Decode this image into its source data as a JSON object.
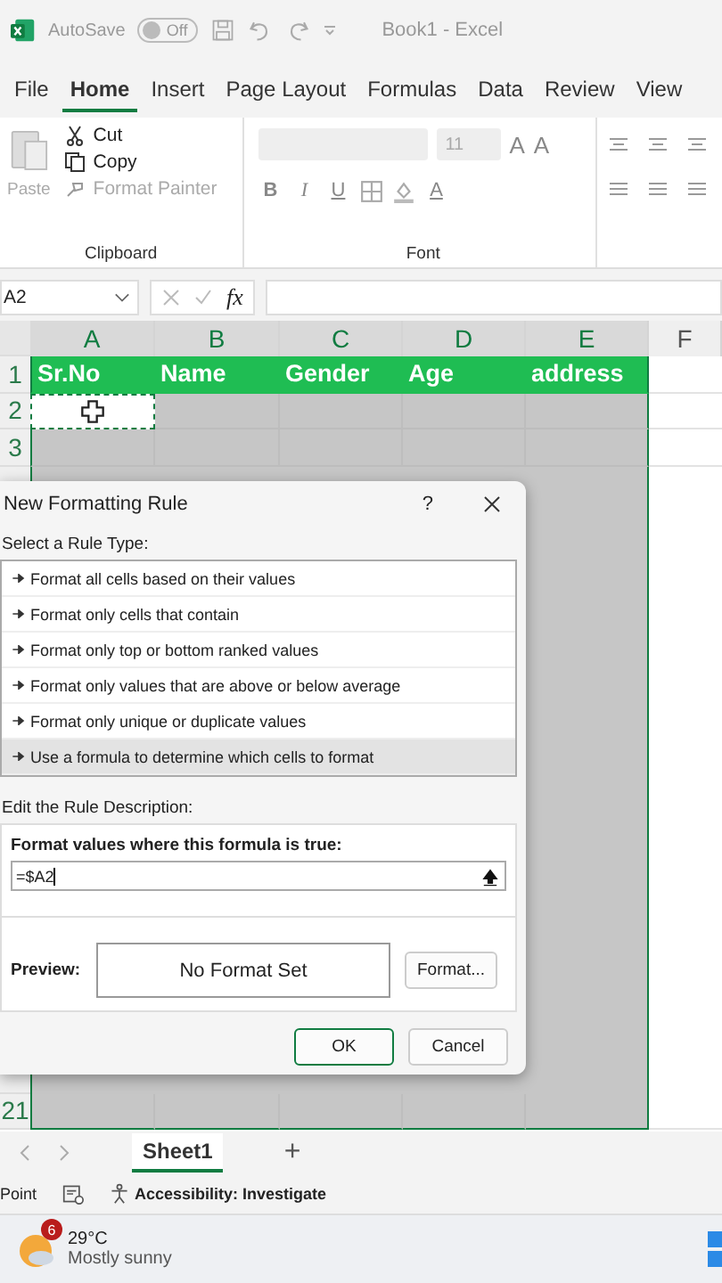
{
  "title_bar": {
    "autosave_label": "AutoSave",
    "autosave_toggle": {
      "label": "Off",
      "on": false
    },
    "document_title": "Book1  -  Excel"
  },
  "menu_tabs": [
    {
      "label": "File",
      "selected": false
    },
    {
      "label": "Home",
      "selected": true
    },
    {
      "label": "Insert",
      "selected": false
    },
    {
      "label": "Page Layout",
      "selected": false
    },
    {
      "label": "Formulas",
      "selected": false
    },
    {
      "label": "Data",
      "selected": false
    },
    {
      "label": "Review",
      "selected": false
    },
    {
      "label": "View",
      "selected": false
    }
  ],
  "ribbon": {
    "clipboard": {
      "paste": {
        "label": "Paste",
        "disabled": true
      },
      "items": [
        {
          "kind": "cut",
          "label": "Cut",
          "disabled": false
        },
        {
          "kind": "copy",
          "label": "Copy",
          "disabled": false
        },
        {
          "kind": "painter",
          "label": "Format Painter",
          "disabled": true
        }
      ],
      "group_label": "Clipboard"
    },
    "font": {
      "font_size": "11",
      "size_buttons": [
        "A",
        "A"
      ],
      "format_buttons": [
        {
          "kind": "bold",
          "label": "B"
        },
        {
          "kind": "italic",
          "label": "I"
        },
        {
          "kind": "underline",
          "label": "U"
        }
      ],
      "font_color_label": "A",
      "group_label": "Font"
    }
  },
  "formula_bar": {
    "name_box": "A2",
    "function_label": "fx"
  },
  "sheet": {
    "columns": [
      "A",
      "B",
      "C",
      "D",
      "E",
      "F"
    ],
    "header_row": {
      "number": "1",
      "cells": [
        "Sr.No",
        "Name",
        "Gender",
        "Age",
        "address"
      ]
    },
    "rows_above_dialog": [
      "2",
      "3"
    ],
    "rows_below_dialog": [
      "21"
    ]
  },
  "dialog": {
    "title": "New Formatting Rule",
    "help": "?",
    "rule_type_label": "Select a Rule Type:",
    "rule_types": [
      {
        "label": "Format all cells based on their values",
        "selected": false
      },
      {
        "label": "Format only cells that contain",
        "selected": false
      },
      {
        "label": "Format only top or bottom ranked values",
        "selected": false
      },
      {
        "label": "Format only values that are above or below average",
        "selected": false
      },
      {
        "label": "Format only unique or duplicate values",
        "selected": false
      },
      {
        "label": "Use a formula to determine which cells to format",
        "selected": true
      }
    ],
    "description_label": "Edit the Rule Description:",
    "formula_label": "Format values where this formula is true:",
    "formula_value": "=$A2",
    "preview_label": "Preview:",
    "preview_text": "No Format Set",
    "format_button": "Format...",
    "buttons": [
      "OK",
      "Cancel"
    ]
  },
  "sheet_tabs": {
    "tabs": [
      {
        "label": "Sheet1",
        "selected": true
      }
    ],
    "add": "+"
  },
  "status_bar": {
    "mode": "Point",
    "accessibility": "Accessibility: Investigate"
  },
  "taskbar": {
    "badge": "6",
    "temperature": "29°C",
    "condition": "Mostly sunny"
  }
}
